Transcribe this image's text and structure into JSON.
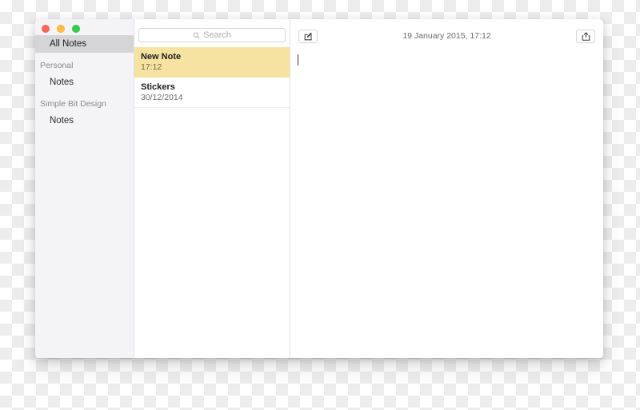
{
  "window": {
    "traffic_lights": [
      {
        "name": "close-button",
        "color": "#f7685c"
      },
      {
        "name": "minimize-button",
        "color": "#fcbd41"
      },
      {
        "name": "zoom-button",
        "color": "#35cd4b"
      }
    ]
  },
  "sidebar": {
    "all_notes": "All Notes",
    "groups": [
      {
        "header": "Personal",
        "items": [
          {
            "label": "Notes"
          }
        ]
      },
      {
        "header": "Simple Bit Design",
        "items": [
          {
            "label": "Notes"
          }
        ]
      }
    ]
  },
  "search": {
    "icon": "search-icon",
    "placeholder": "Search",
    "value": ""
  },
  "note_list": {
    "notes": [
      {
        "title": "New Note",
        "date": "17:12",
        "selected": true
      },
      {
        "title": "Stickers",
        "date": "30/12/2014",
        "selected": false
      }
    ]
  },
  "editor": {
    "compose_button_label": "compose-icon",
    "share_button_label": "share-icon",
    "timestamp": "19 January 2015, 17:12",
    "body_text": ""
  },
  "colors": {
    "selected_note_bg": "#f7e3a1",
    "sidebar_bg": "#f4f3f5",
    "sidebar_selection_bg": "#d5d4d6",
    "editor_bg": "#ffffff"
  }
}
